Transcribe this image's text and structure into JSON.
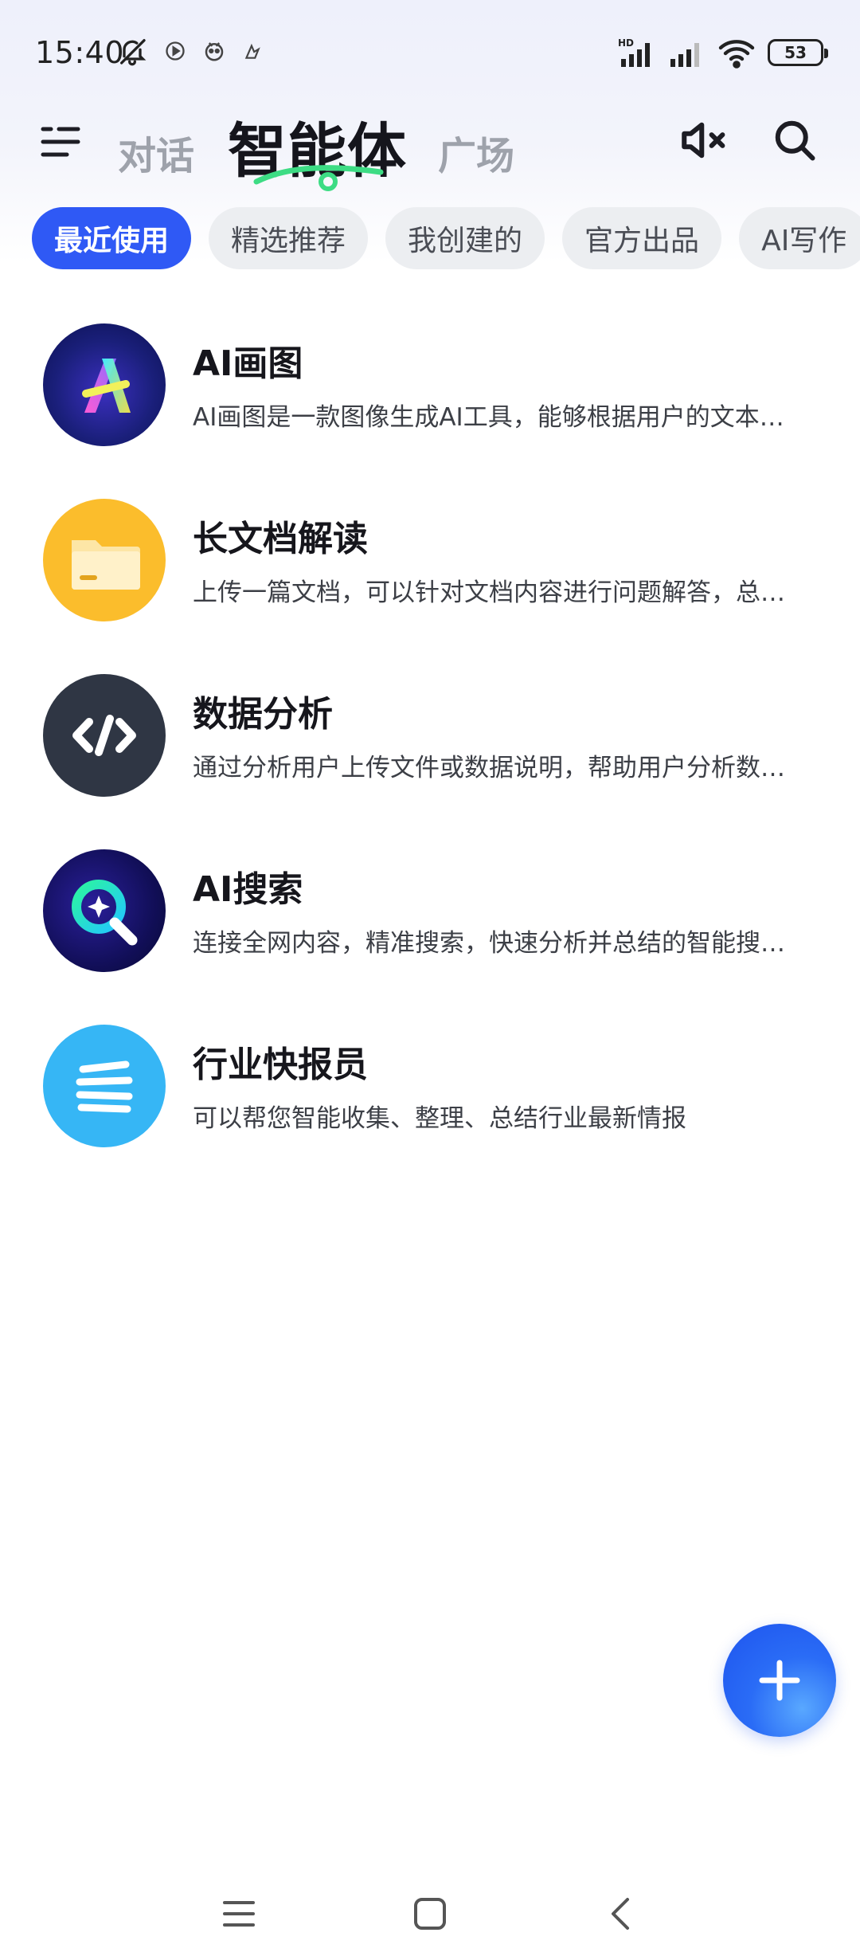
{
  "status_bar": {
    "time": "15:40",
    "notification_icons": [
      "bell-off-icon",
      "app-notify-icon-1",
      "app-notify-icon-2",
      "app-notify-icon-3"
    ],
    "signal_label": "HD",
    "battery": "53"
  },
  "header": {
    "tabs": [
      {
        "label": "对话",
        "active": false
      },
      {
        "label": "智能体",
        "active": true
      },
      {
        "label": "广场",
        "active": false
      }
    ],
    "accent": "#3ddc84"
  },
  "filters": [
    {
      "label": "最近使用",
      "active": true
    },
    {
      "label": "精选推荐",
      "active": false
    },
    {
      "label": "我创建的",
      "active": false
    },
    {
      "label": "官方出品",
      "active": false
    },
    {
      "label": "AI写作",
      "active": false
    }
  ],
  "agents": [
    {
      "name": "AI画图",
      "desc": "AI画图是一款图像生成AI工具，能够根据用户的文本描述生成图片",
      "icon": "ai-drawing-icon"
    },
    {
      "name": "长文档解读",
      "desc": "上传一篇文档，可以针对文档内容进行问题解答，总结摘要",
      "icon": "folder-icon"
    },
    {
      "name": "数据分析",
      "desc": "通过分析用户上传文件或数据说明，帮助用户分析数据并生成图表",
      "icon": "code-icon"
    },
    {
      "name": "AI搜索",
      "desc": "连接全网内容，精准搜索，快速分析并总结的智能搜索助手",
      "icon": "ai-search-icon"
    },
    {
      "name": "行业快报员",
      "desc": "可以帮您智能收集、整理、总结行业最新情报",
      "icon": "news-lines-icon"
    }
  ],
  "colors": {
    "primary": "#2f59f5",
    "chip_bg": "#eceef1",
    "folder": "#fbbd2c",
    "code_bg": "#2f3644",
    "news_bg": "#36b6f5"
  }
}
